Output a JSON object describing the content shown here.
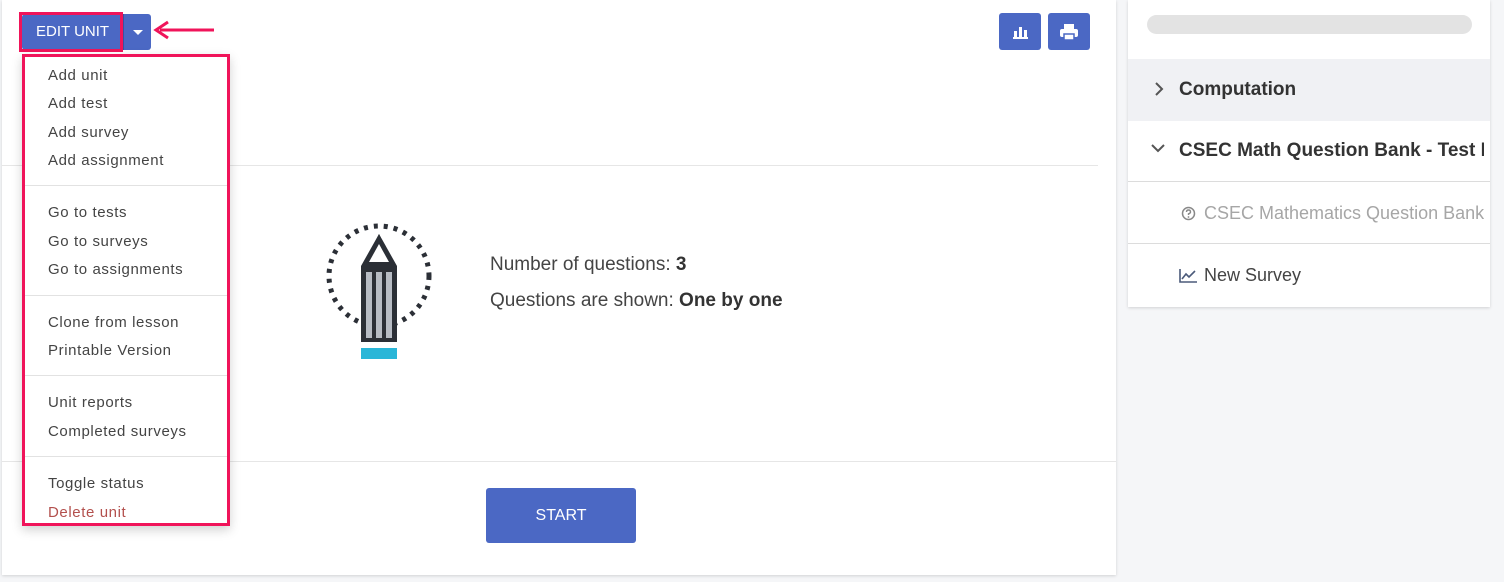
{
  "toolbar": {
    "edit_label": "EDIT UNIT",
    "stats_icon": "bar-chart-icon",
    "print_icon": "printer-icon"
  },
  "menu": {
    "groups": [
      [
        "Add unit",
        "Add test",
        "Add survey",
        "Add assignment"
      ],
      [
        "Go to tests",
        "Go to surveys",
        "Go to assignments"
      ],
      [
        "Clone from lesson",
        "Printable Version"
      ],
      [
        "Unit reports",
        "Completed surveys"
      ],
      [
        "Toggle status",
        "Delete unit"
      ]
    ]
  },
  "content": {
    "questions_label": "Number of questions:",
    "questions_value": "3",
    "shown_label": "Questions are shown:",
    "shown_value": "One by one",
    "start_label": "START"
  },
  "sidebar": {
    "items": [
      {
        "label": "Computation",
        "icon": "chevron-right-icon"
      },
      {
        "label": "CSEC Math Question Bank - Test M...",
        "icon": "chevron-down-icon"
      },
      {
        "label": "CSEC Mathematics Question Bank",
        "icon": "question-circle-icon"
      },
      {
        "label": "New Survey",
        "icon": "line-chart-icon"
      }
    ]
  },
  "colors": {
    "primary": "#4b68c4",
    "highlight": "#f0145a",
    "danger": "#b3504d",
    "pencil_tip": "#29b6d8"
  }
}
